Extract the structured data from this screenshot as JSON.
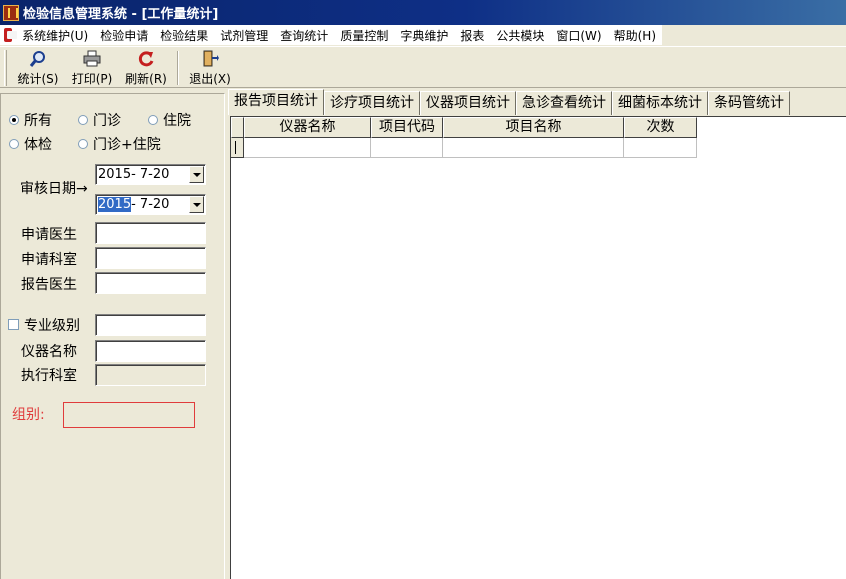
{
  "window": {
    "title": "检验信息管理系统 - [工作量统计]"
  },
  "menubar": {
    "items": [
      "系统维护(U)",
      "检验申请",
      "检验结果",
      "试剂管理",
      "查询统计",
      "质量控制",
      "字典维护",
      "报表",
      "公共模块",
      "窗口(W)",
      "帮助(H)"
    ]
  },
  "toolbar": {
    "stat_label": "统计(S)",
    "print_label": "打印(P)",
    "refresh_label": "刷新(R)",
    "exit_label": "退出(X)"
  },
  "filters": {
    "scope_options": [
      "所有",
      "门诊",
      "住院",
      "体检",
      "门诊+住院"
    ],
    "scope_selected": "所有",
    "audit_date_label": "审核日期→",
    "date_from": "2015- 7-20",
    "date_to_year": "2015",
    "date_to_rest": "- 7-20",
    "apply_doctor_label": "申请医生",
    "apply_dept_label": "申请科室",
    "report_doctor_label": "报告医生",
    "specialty_label": "专业级别",
    "instrument_label": "仪器名称",
    "exec_dept_label": "执行科室",
    "group_label": "组别:"
  },
  "tabs": [
    "报告项目统计",
    "诊疗项目统计",
    "仪器项目统计",
    "急诊查看统计",
    "细菌标本统计",
    "条码管统计"
  ],
  "tabs_active": 0,
  "grid": {
    "columns": [
      "仪器名称",
      "项目代码",
      "项目名称",
      "次数"
    ]
  },
  "colors": {
    "title_bar": "#0a246a",
    "face": "#ece9d8",
    "group_accent": "#e03c3c",
    "selection": "#316ac5"
  }
}
